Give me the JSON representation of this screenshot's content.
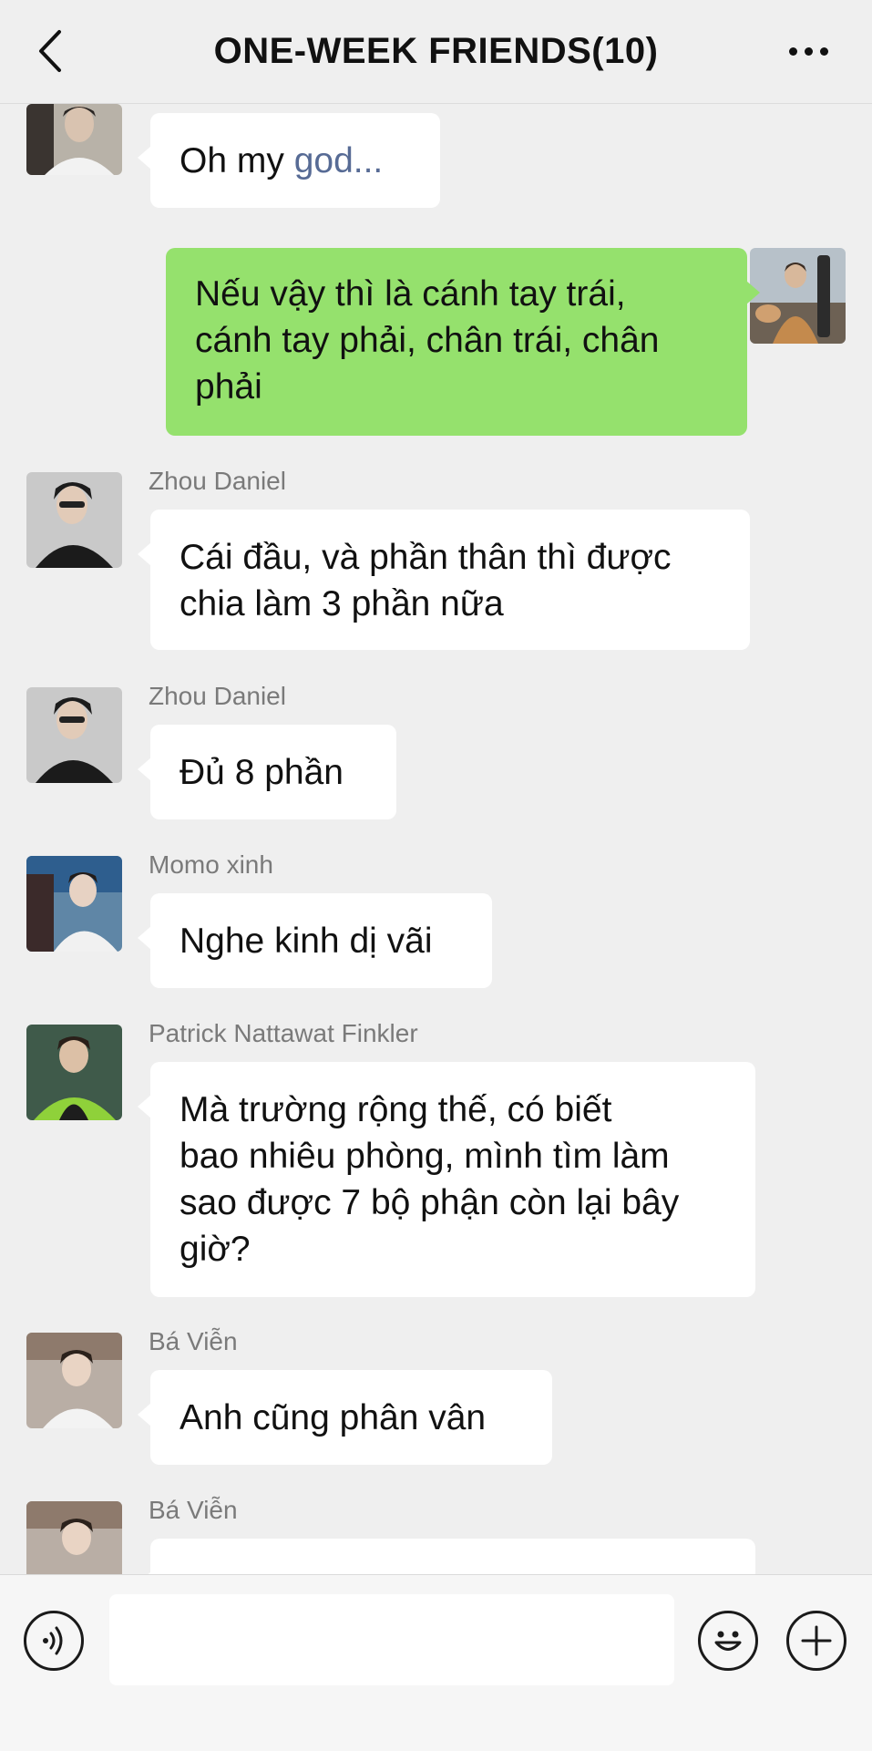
{
  "header": {
    "title": "ONE-WEEK FRIENDS(10)",
    "back_icon": "chevron-left-icon",
    "more_icon": "more-dots-icon"
  },
  "colors": {
    "background": "#efefef",
    "bubble_self": "#95e16d",
    "bubble_other": "#ffffff",
    "sender_name": "#7a7a7a",
    "link": "#576b95"
  },
  "messages": [
    {
      "side": "left",
      "sender": "",
      "text_plain": "Oh my ",
      "text_link": "god...",
      "avatar": "avatar-boy-white-shirt"
    },
    {
      "side": "right",
      "sender": "",
      "lines": [
        "Nếu vậy thì là cánh tay trái,",
        "cánh tay phải, chân trái, chân",
        "phải"
      ],
      "avatar": "avatar-self-guitar"
    },
    {
      "side": "left",
      "sender": "Zhou Daniel",
      "lines": [
        "Cái đầu, và phần thân thì được",
        "chia làm 3 phần nữa"
      ],
      "avatar": "avatar-zhou-daniel"
    },
    {
      "side": "left",
      "sender": "Zhou Daniel",
      "lines": [
        "Đủ 8 phần"
      ],
      "avatar": "avatar-zhou-daniel"
    },
    {
      "side": "left",
      "sender": "Momo xinh",
      "lines": [
        "Nghe kinh dị vãi"
      ],
      "avatar": "avatar-momo-xinh"
    },
    {
      "side": "left",
      "sender": "Patrick Nattawat Finkler",
      "lines": [
        "Mà trường rộng thế, có biết",
        "bao nhiêu phòng, mình tìm làm",
        "sao được 7 bộ phận còn lại bây",
        "giờ?"
      ],
      "avatar": "avatar-patrick"
    },
    {
      "side": "left",
      "sender": "Bá Viễn",
      "lines": [
        "Anh cũng phân vân"
      ],
      "avatar": "avatar-ba-vien"
    },
    {
      "side": "left",
      "sender": "Bá Viễn",
      "lines": [
        ""
      ],
      "avatar": "avatar-ba-vien"
    }
  ],
  "input_bar": {
    "voice_icon": "voice-icon",
    "emoji_icon": "emoji-icon",
    "plus_icon": "plus-icon",
    "input_value": ""
  }
}
